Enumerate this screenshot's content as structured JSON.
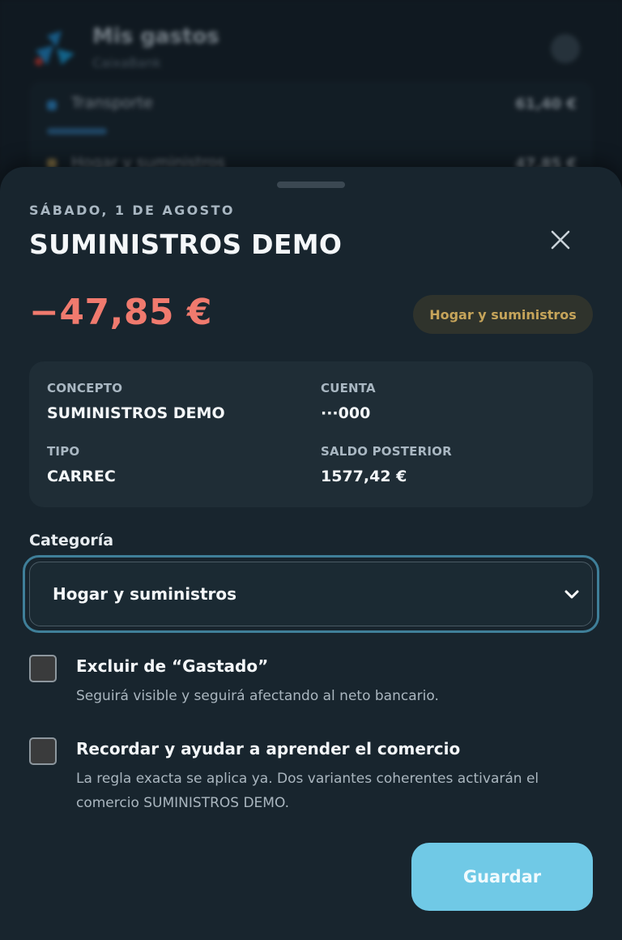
{
  "background": {
    "title": "Mis gastos",
    "subtitle": "CaixaBank",
    "rows": [
      {
        "label": "Transporte",
        "amount": "61,40 €",
        "color": "#2d8fd6"
      },
      {
        "label": "Hogar y suministros",
        "amount": "47,85 €",
        "color": "#c6a45a"
      }
    ]
  },
  "sheet": {
    "date": "SÁBADO, 1 DE AGOSTO",
    "title": "SUMINISTROS DEMO",
    "close_icon": "close-icon",
    "amount": "−47,85 €",
    "amount_color": "#f07a6e",
    "category_badge": "Hogar y suministros",
    "details": {
      "concepto_label": "CONCEPTO",
      "concepto_value": "SUMINISTROS DEMO",
      "cuenta_label": "CUENTA",
      "cuenta_value": "···000",
      "tipo_label": "TIPO",
      "tipo_value": "CARREC",
      "saldo_label": "SALDO POSTERIOR",
      "saldo_value": "1577,42 €"
    },
    "category_field": {
      "label": "Categoría",
      "selected": "Hogar y suministros"
    },
    "exclude_option": {
      "title": "Excluir de “Gastado”",
      "description": "Seguirá visible y seguirá afectando al neto bancario.",
      "checked": false
    },
    "remember_option": {
      "title": "Recordar y ayudar a aprender el comercio",
      "description": "La regla exacta se aplica ya. Dos variantes coherentes activarán el comercio SUMINISTROS DEMO.",
      "checked": false
    },
    "save_label": "Guardar",
    "accent_color": "#70c9e6"
  }
}
